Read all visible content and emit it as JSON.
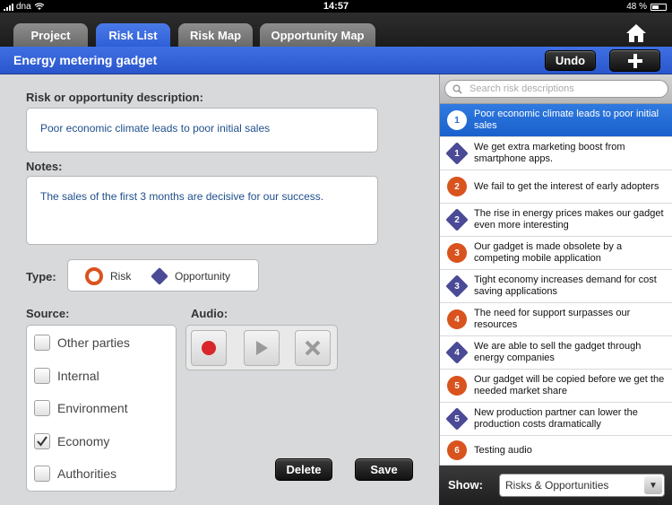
{
  "status": {
    "carrier": "dna",
    "time": "14:57",
    "battery": "48 %"
  },
  "tabs": [
    {
      "label": "Project"
    },
    {
      "label": "Risk List"
    },
    {
      "label": "Risk Map"
    },
    {
      "label": "Opportunity Map"
    }
  ],
  "header": {
    "title": "Energy metering gadget",
    "undo_label": "Undo"
  },
  "form": {
    "description_label": "Risk or opportunity description:",
    "description_value": "Poor economic climate leads to poor initial sales",
    "notes_label": "Notes:",
    "notes_value": "The sales of the first 3 months are decisive for our success.",
    "type_label": "Type:",
    "type_risk": "Risk",
    "type_opportunity": "Opportunity",
    "source_label": "Source:",
    "audio_label": "Audio:",
    "sources": [
      {
        "label": "Other parties",
        "checked": false
      },
      {
        "label": "Internal",
        "checked": false
      },
      {
        "label": "Environment",
        "checked": false
      },
      {
        "label": "Economy",
        "checked": true
      },
      {
        "label": "Authorities",
        "checked": false
      }
    ],
    "delete_label": "Delete",
    "save_label": "Save"
  },
  "search": {
    "placeholder": "Search risk descriptions"
  },
  "list": [
    {
      "kind": "risk",
      "num": "1",
      "text": "Poor economic climate leads to poor initial sales",
      "selected": true
    },
    {
      "kind": "opp",
      "num": "1",
      "text": "We get extra marketing boost from smartphone apps."
    },
    {
      "kind": "risk",
      "num": "2",
      "text": "We fail to get the interest of early adopters"
    },
    {
      "kind": "opp",
      "num": "2",
      "text": "The rise in energy prices makes our gadget even more interesting"
    },
    {
      "kind": "risk",
      "num": "3",
      "text": "Our gadget is made obsolete by a competing mobile application"
    },
    {
      "kind": "opp",
      "num": "3",
      "text": "Tight economy increases demand for cost saving applications"
    },
    {
      "kind": "risk",
      "num": "4",
      "text": "The need for support surpasses our resources"
    },
    {
      "kind": "opp",
      "num": "4",
      "text": "We are able to sell the gadget through energy companies"
    },
    {
      "kind": "risk",
      "num": "5",
      "text": "Our gadget will be copied before we get the needed market share"
    },
    {
      "kind": "opp",
      "num": "5",
      "text": "New production partner can lower the production costs dramatically"
    },
    {
      "kind": "risk",
      "num": "6",
      "text": "Testing audio"
    }
  ],
  "show": {
    "label": "Show:",
    "value": "Risks & Opportunities"
  },
  "colors": {
    "accent": "#2f5fd6",
    "risk": "#d9531e",
    "opportunity": "#4a4a96"
  }
}
